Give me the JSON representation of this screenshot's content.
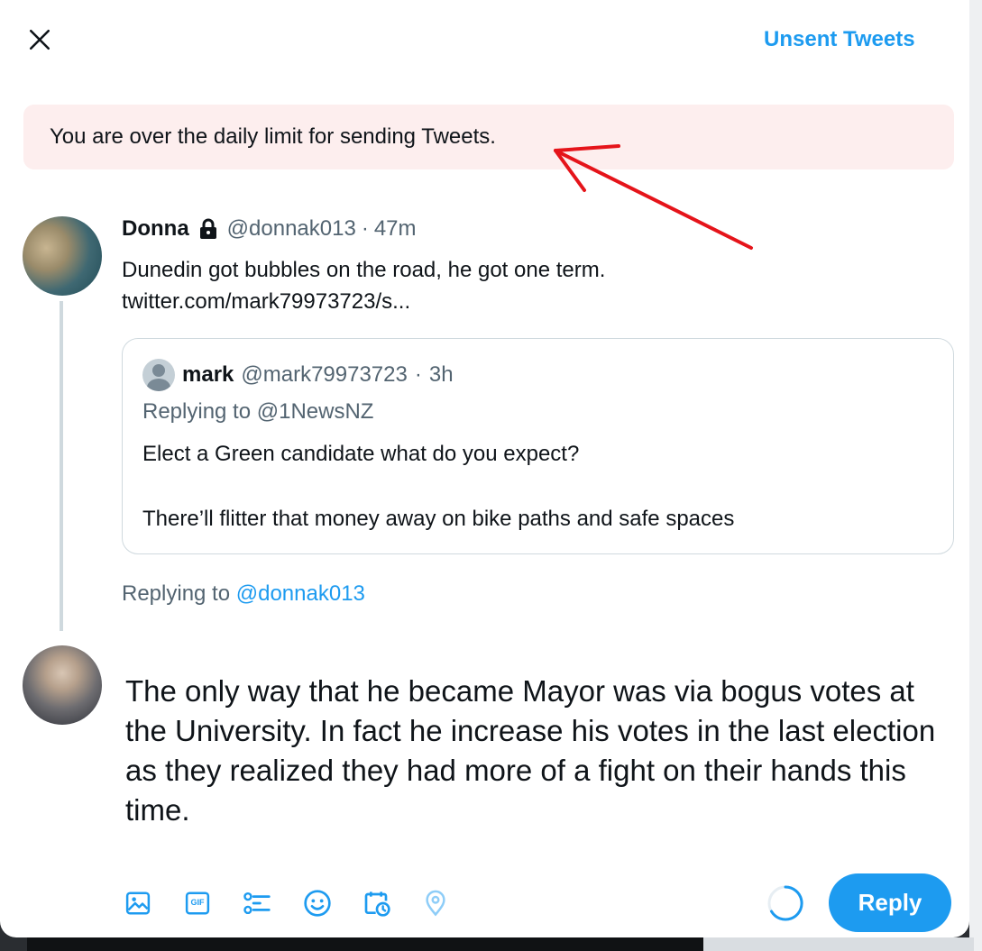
{
  "header": {
    "close_icon": "close-icon",
    "unsent_label": "Unsent Tweets"
  },
  "alert": {
    "message": "You are over the daily limit for sending Tweets.",
    "annotation_color": "#e5141a"
  },
  "tweet": {
    "name": "Donna",
    "handle": "@donnak013",
    "separator": "·",
    "time": "47m",
    "protected_icon": "lock-icon",
    "text_line1": "Dunedin got bubbles on the road, he got one term.",
    "text_line2": "twitter.com/mark79973723/s..."
  },
  "quoted_tweet": {
    "name": "mark",
    "handle": "@mark79973723",
    "separator": "·",
    "time": "3h",
    "replying_to": "Replying to @1NewsNZ",
    "line1": "Elect a Green candidate what do you expect?",
    "line2": "There’ll flitter that money away on bike paths and safe spaces"
  },
  "replying": {
    "prefix": "Replying to",
    "handle": "@donnak013"
  },
  "compose": {
    "text": "The only way that he became Mayor was via bogus votes at the University. In fact he increase his votes in the last election as they realized they had more of a fight on their hands this time."
  },
  "toolbar": {
    "icons": [
      "image-icon",
      "gif-icon",
      "poll-icon",
      "emoji-icon",
      "schedule-icon",
      "location-icon"
    ],
    "gif_label": "GIF",
    "reply_label": "Reply"
  },
  "colors": {
    "accent": "#1d9bf0",
    "alert_bg": "#fdeeee",
    "text_secondary": "#536471"
  }
}
